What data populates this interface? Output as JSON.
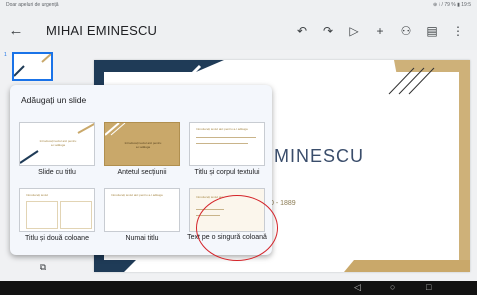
{
  "status_bar": {
    "left_text": "Doar apeluri de urgență",
    "right_text": "⊕ ⁝ / 79 % ▮ 19:5"
  },
  "app_bar": {
    "back_icon": "arrow-left-icon",
    "title": "MIHAI EMINESCU",
    "tools": [
      {
        "name": "undo-icon",
        "glyph": "↶"
      },
      {
        "name": "redo-icon",
        "glyph": "↷"
      },
      {
        "name": "play-icon",
        "glyph": "▷"
      },
      {
        "name": "add-icon",
        "glyph": "+"
      },
      {
        "name": "add-person-icon",
        "glyph": "⚇"
      },
      {
        "name": "comment-icon",
        "glyph": "▤"
      },
      {
        "name": "more-icon",
        "glyph": "⋮"
      }
    ]
  },
  "thumbnail": {
    "number": "1"
  },
  "slide": {
    "title_fragment": "MINESCU",
    "year_fragment": "0 - 1889"
  },
  "popup": {
    "title": "Adăugați un slide",
    "layouts": [
      {
        "label": "Slide cu titlu",
        "thumb_text": "Introduceți textul aici pentru a-l adăuga"
      },
      {
        "label": "Antetul secțiunii",
        "thumb_text": "Introduceți textul aici pentru a-l adăuga"
      },
      {
        "label": "Titlu și corpul textului",
        "thumb_text": "Introduceți textul aici pentru a-l adăuga"
      },
      {
        "label": "Titlu și două coloane",
        "thumb_text": "Introduceți textul"
      },
      {
        "label": "Numai titlu",
        "thumb_text": "Introduceți textul aici pentru a-l adăuga"
      },
      {
        "label": "Text pe o singură coloană",
        "thumb_text": "Introduceți textul aici"
      }
    ]
  },
  "nav_bar": {
    "back": "◁",
    "home": "○",
    "recents": "□"
  },
  "colors": {
    "accent": "#1a73e8",
    "navy": "#1f3b57",
    "gold": "#c9a86a",
    "highlight": "#d4242a"
  }
}
